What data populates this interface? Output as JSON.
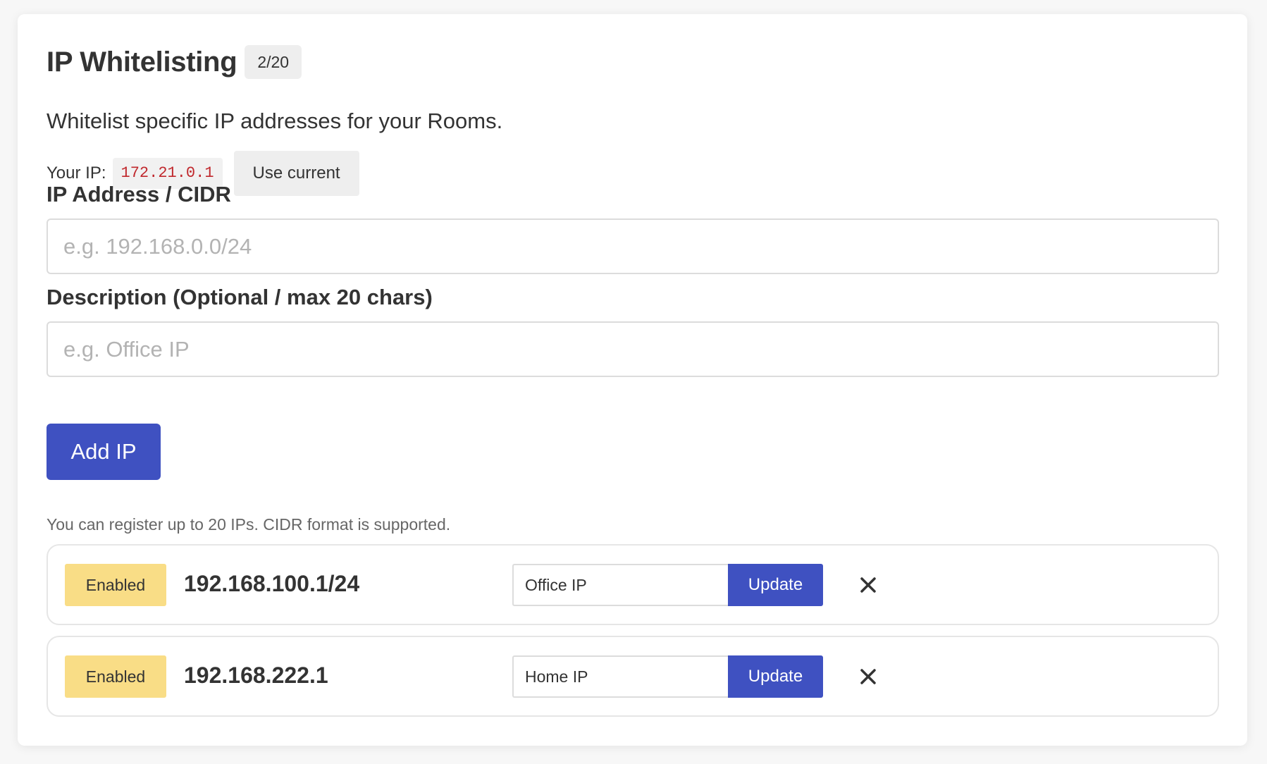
{
  "header": {
    "title": "IP Whitelisting",
    "count_badge": "2/20",
    "subtitle": "Whitelist specific IP addresses for your Rooms."
  },
  "current_ip": {
    "label": "Your IP:",
    "value": "172.21.0.1",
    "use_current_label": "Use current"
  },
  "form": {
    "ip_label": "IP Address / CIDR",
    "ip_placeholder": "e.g. 192.168.0.0/24",
    "ip_value": "",
    "description_label": "Description (Optional / max 20 chars)",
    "description_placeholder": "e.g. Office IP",
    "description_value": "",
    "add_button_label": "Add IP",
    "help_text": "You can register up to 20 IPs. CIDR format is supported."
  },
  "entries": [
    {
      "status": "Enabled",
      "ip": "192.168.100.1/24",
      "description": "Office IP",
      "update_label": "Update",
      "delete_icon": "close-icon"
    },
    {
      "status": "Enabled",
      "ip": "192.168.222.1",
      "description": "Home IP",
      "update_label": "Update",
      "delete_icon": "close-icon"
    }
  ],
  "colors": {
    "primary": "#3f51c1",
    "status_enabled_bg": "#f9dd86",
    "ip_value_text": "#c0282d"
  }
}
